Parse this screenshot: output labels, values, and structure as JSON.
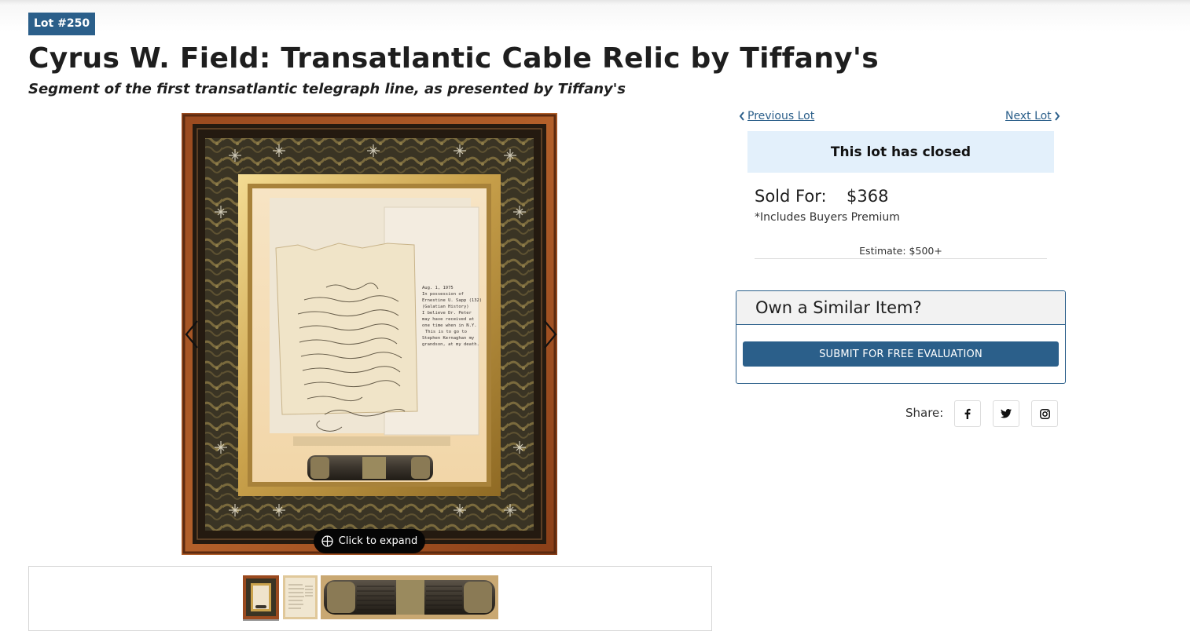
{
  "lot": {
    "badge": "Lot #250",
    "title": "Cyrus W. Field: Transatlantic Cable Relic by Tiffany's",
    "subtitle": "Segment of the first transatlantic telegraph line, as presented by Tiffany's"
  },
  "gallery": {
    "expand_label": "Click to expand",
    "thumbnails": 3,
    "active_thumbnail": 1,
    "letter_note": [
      "Aug. 1, 1975",
      "In possession of",
      "Ernestine U. Sapp (132)",
      "(Galatian History)",
      "I believe Dr. Peter",
      "may have received at",
      "one time when in N.Y.",
      "This is to go to",
      "Stephen Kernaghan my",
      "grandson, at my death."
    ],
    "letter_script": [
      "New York, Aug. 21 1858",
      "This is to certify that I have",
      "sold the balance of the Atlantic",
      "Telegraph Cable now on board of",
      "the U. S. S. Niagara to",
      "Messrs Tiffany & Co Jewellers",
      "No 550 Broadway of this",
      "city, and that the piece which",
      "accompanies this, is a genuine",
      "section thereof",
      "Cyrus W. Field"
    ]
  },
  "navigation": {
    "previous": "Previous Lot",
    "next": "Next Lot"
  },
  "status": {
    "closed_text": "This lot has closed",
    "sold_label": "Sold For:",
    "sold_value": "$368",
    "premium_note": "*Includes Buyers Premium",
    "estimate": "Estimate: $500+"
  },
  "similar": {
    "heading": "Own a Similar Item?",
    "button": "SUBMIT FOR FREE EVALUATION"
  },
  "share": {
    "label": "Share:",
    "icons": [
      "facebook-icon",
      "twitter-icon",
      "instagram-icon"
    ]
  },
  "colors": {
    "brand_blue": "#2b5f8a",
    "closed_bg": "#e3f0fb"
  }
}
